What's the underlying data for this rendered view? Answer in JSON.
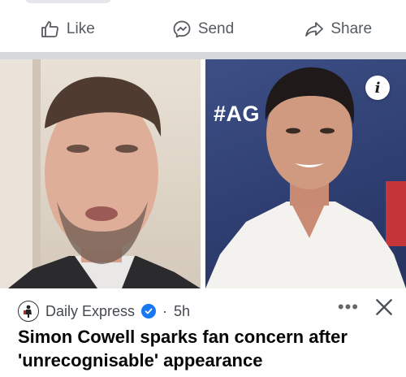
{
  "actions": {
    "like_label": "Like",
    "send_label": "Send",
    "share_label": "Share"
  },
  "post": {
    "info_badge": "i",
    "photo_overlay_text": "#AG",
    "source": "Daily Express",
    "separator": "·",
    "time": "5h",
    "more": "•••",
    "headline": "Simon Cowell sparks fan concern after 'unrecognisable' appearance"
  },
  "colors": {
    "action_text": "#555a61",
    "divider": "#d6d8dc",
    "verified": "#1877f2",
    "headline": "#050505"
  },
  "icons": [
    "like-icon",
    "send-icon",
    "share-icon",
    "info-icon",
    "verified-icon",
    "more-icon",
    "close-icon",
    "daily-express-logo"
  ]
}
